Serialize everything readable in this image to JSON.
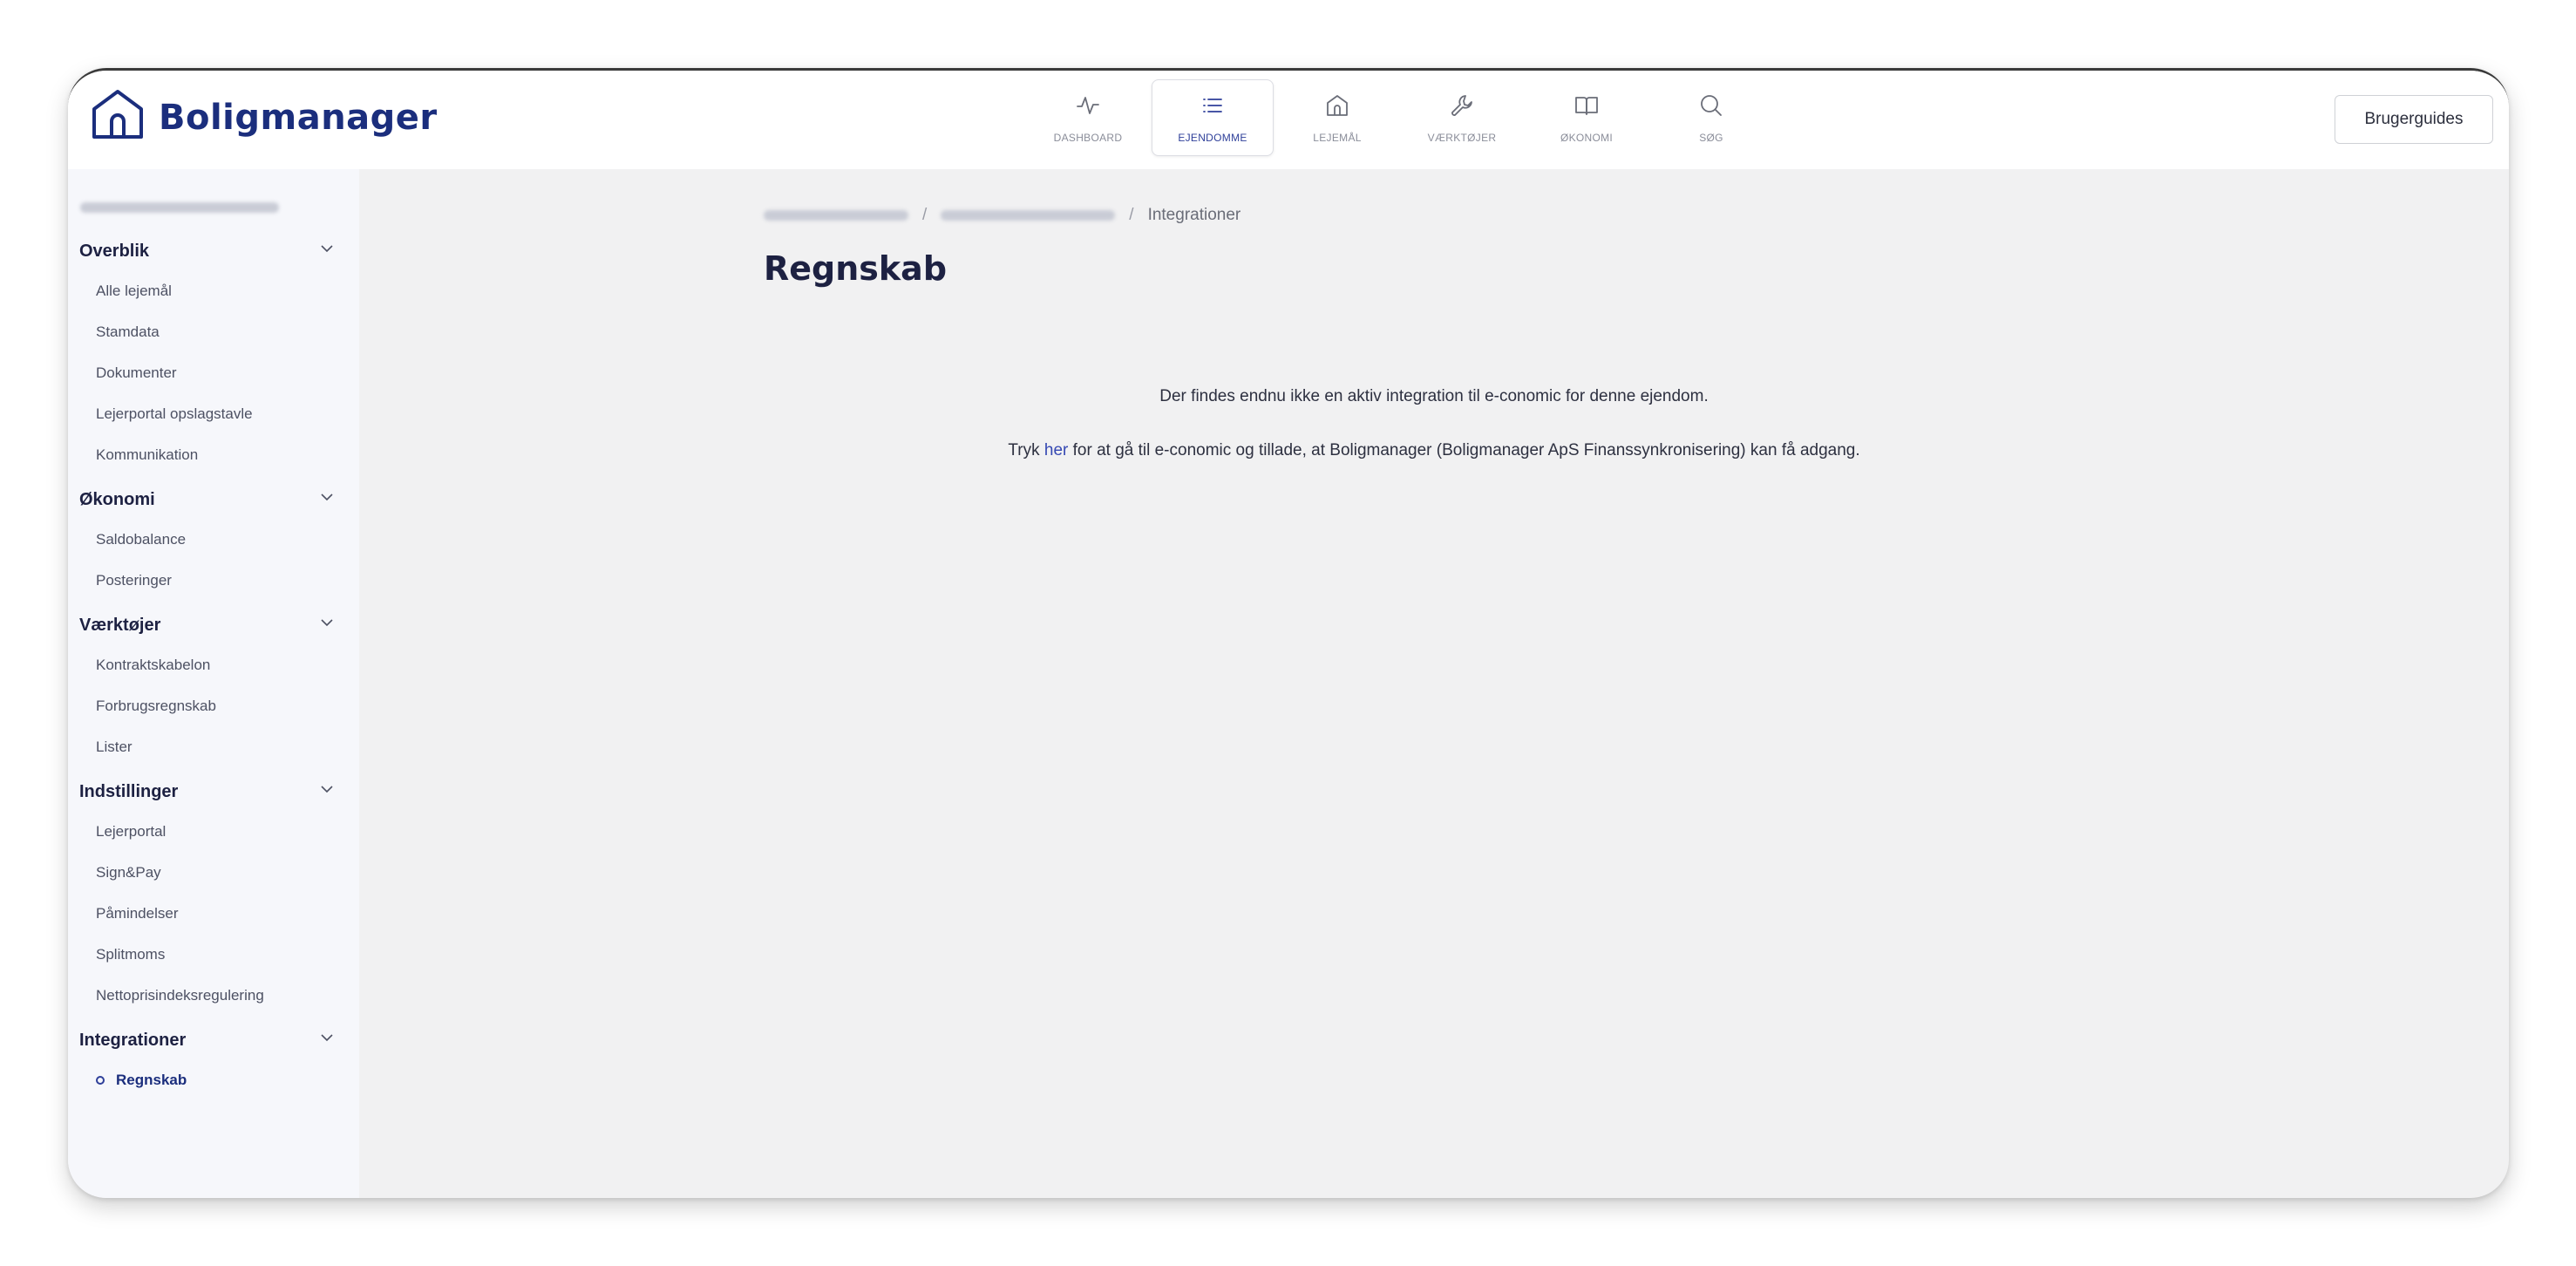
{
  "app": {
    "logo_text": "Boligmanager",
    "brand_color": "#1b2e7d",
    "accent_color": "#2e3f99"
  },
  "nav": {
    "items": [
      {
        "label": "DASHBOARD",
        "icon": "activity-icon"
      },
      {
        "label": "EJENDOMME",
        "icon": "list-icon",
        "active": true
      },
      {
        "label": "LEJEMÅL",
        "icon": "house-icon"
      },
      {
        "label": "VÆRKTØJER",
        "icon": "wrench-icon"
      },
      {
        "label": "ØKONOMI",
        "icon": "book-icon"
      },
      {
        "label": "SØG",
        "icon": "search-icon"
      }
    ],
    "guide_button": "Brugerguides"
  },
  "sidebar": {
    "sections": [
      {
        "title": "Overblik",
        "items": [
          "Alle lejemål",
          "Stamdata",
          "Dokumenter",
          "Lejerportal opslagstavle",
          "Kommunikation"
        ]
      },
      {
        "title": "Økonomi",
        "items": [
          "Saldobalance",
          "Posteringer"
        ]
      },
      {
        "title": "Værktøjer",
        "items": [
          "Kontraktskabelon",
          "Forbrugsregnskab",
          "Lister"
        ]
      },
      {
        "title": "Indstillinger",
        "items": [
          "Lejerportal",
          "Sign&Pay",
          "Påmindelser",
          "Splitmoms",
          "Nettoprisindeksregulering"
        ]
      },
      {
        "title": "Integrationer",
        "items": [
          "Regnskab"
        ]
      }
    ]
  },
  "breadcrumb": {
    "current": "Integrationer"
  },
  "page": {
    "title": "Regnskab",
    "message_line1": "Der findes endnu ikke en aktiv integration til e-conomic for denne ejendom.",
    "message_line2_prefix": "Tryk ",
    "message_line2_link": "her",
    "message_line2_suffix": " for at gå til e-conomic og tillade, at Boligmanager (Boligmanager ApS Finanssynkronisering) kan få adgang."
  }
}
